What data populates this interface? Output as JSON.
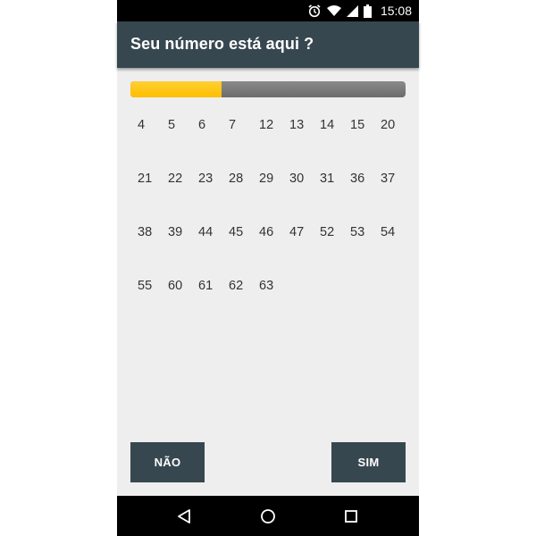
{
  "status_bar": {
    "time": "15:08",
    "icons": [
      "alarm-icon",
      "wifi-icon",
      "signal-icon",
      "battery-icon"
    ]
  },
  "app_bar": {
    "title": "Seu número está aqui ?"
  },
  "progress": {
    "fraction": 0.33,
    "fill_color": "#ffc107",
    "track_color": "#757575"
  },
  "numbers": [
    "4",
    "5",
    "6",
    "7",
    "12",
    "13",
    "14",
    "15",
    "20",
    "21",
    "22",
    "23",
    "28",
    "29",
    "30",
    "31",
    "36",
    "37",
    "38",
    "39",
    "44",
    "45",
    "46",
    "47",
    "52",
    "53",
    "54",
    "55",
    "60",
    "61",
    "62",
    "63"
  ],
  "buttons": {
    "no_label": "NÃO",
    "yes_label": "SIM"
  },
  "nav_bar": {
    "icons": [
      "back-icon",
      "home-icon",
      "recents-icon"
    ]
  },
  "colors": {
    "primary": "#37474f",
    "accent": "#ffc107",
    "background": "#eeeeee"
  }
}
